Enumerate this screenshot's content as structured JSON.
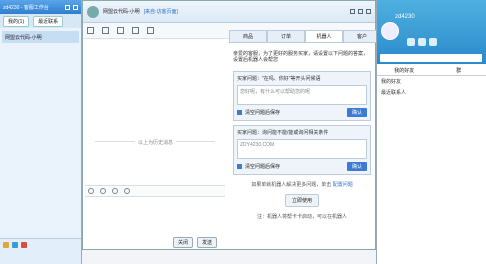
{
  "left": {
    "title": "zd4230 - 客服工作台",
    "tabs": [
      "我的(1)",
      "最近联系"
    ],
    "contact": "网盟云代码-小明"
  },
  "chat": {
    "title": "网盟云代码-小明",
    "subtitle": "[来自:访客页面]",
    "tabs": [
      "商品",
      "订单",
      "机器人",
      "客户"
    ],
    "msgarea_label": "以上为历史消息",
    "buttons": [
      "关闭",
      "发送"
    ]
  },
  "panel": {
    "intro": "亲爱的客服，为了更好的服务买家，请设置以下问题的答案，设置后机器人会帮您",
    "q1": "买家问题：\"在吗、你好\"等开头问候语",
    "q1_answer": "您好呢，有什么可以帮助您的呢",
    "q2": "买家问题：询问能不能/能或询问相关条件",
    "q2_answer": "ZDY4230.COM",
    "checkbox_label": "清空问题后保存",
    "ok": "确认",
    "note": "如果单就机器人解决更多问题，单击",
    "link": "配置问题",
    "start": "立即使用",
    "tip": "注：机器人将帮卡卡启动，可以在机器人"
  },
  "right": {
    "name": "zd4230",
    "tabs": [
      "我的好友",
      "群"
    ],
    "groups": [
      "我的好友",
      "最近联系人"
    ]
  }
}
